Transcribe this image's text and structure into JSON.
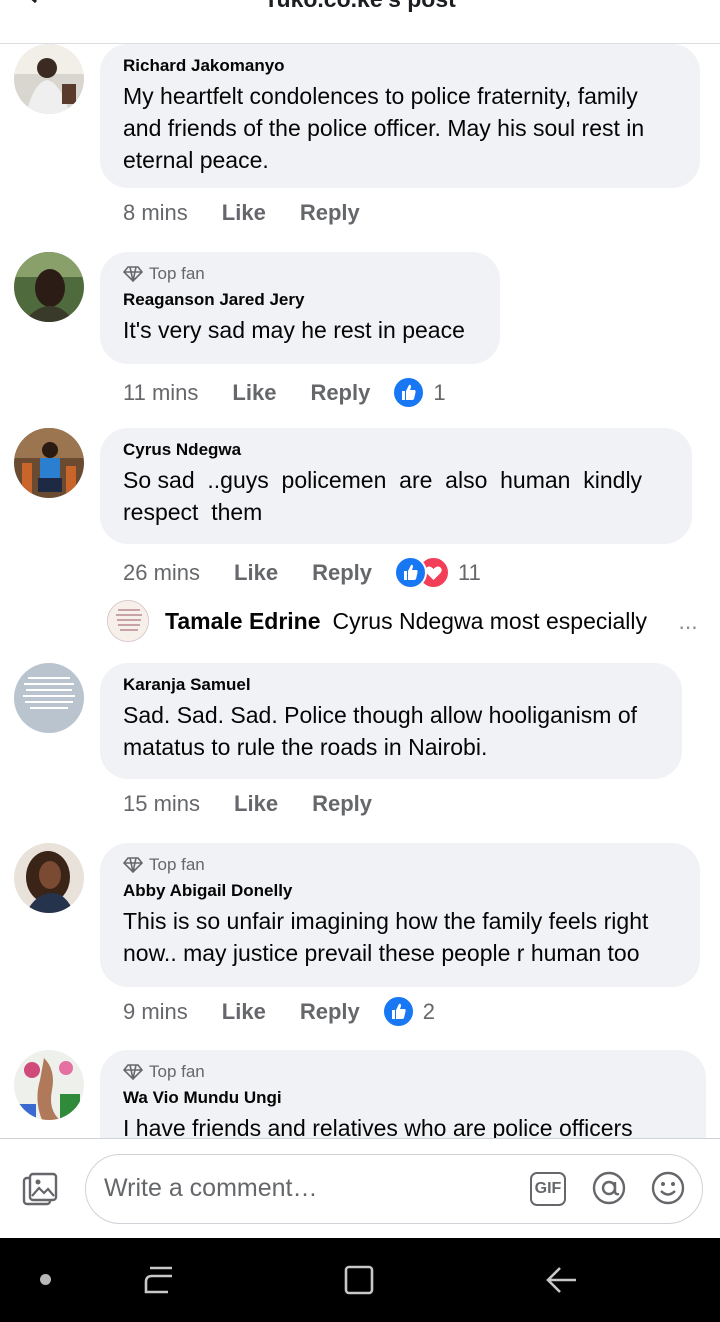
{
  "header": {
    "title": "Tuko.co.ke's post"
  },
  "comments": [
    {
      "author": "Richard Jakomanyo",
      "badge": "",
      "text": "My heartfelt condolences to police fraternity, family and friends of the police officer. May his soul rest in eternal peace.",
      "time": "8 mins",
      "like": "Like",
      "reply": "Reply",
      "reaction_count": ""
    },
    {
      "author": "Reaganson Jared Jery",
      "badge": "Top fan",
      "text": "It's very sad may he rest in peace",
      "time": "11 mins",
      "like": "Like",
      "reply": "Reply",
      "reaction_count": "1"
    },
    {
      "author": "Cyrus Ndegwa",
      "badge": "",
      "text": "So sad  ..guys  policemen  are  also  human  kindly respect  them",
      "time": "26 mins",
      "like": "Like",
      "reply": "Reply",
      "reaction_count": "11"
    },
    {
      "author": "Karanja Samuel",
      "badge": "",
      "text": "Sad. Sad. Sad. Police though allow hooliganism of matatus to rule the roads in Nairobi.",
      "time": "15 mins",
      "like": "Like",
      "reply": "Reply",
      "reaction_count": ""
    },
    {
      "author": "Abby Abigail Donelly",
      "badge": "Top fan",
      "text": "This is so unfair imagining how the family feels right now.. may justice prevail these people r human too",
      "time": "9 mins",
      "like": "Like",
      "reply": "Reply",
      "reaction_count": "2"
    },
    {
      "author": "Wa Vio Mundu Ungi",
      "badge": "Top fan",
      "text": "I have friends and relatives who are police officers",
      "time": "",
      "like": "",
      "reply": "",
      "reaction_count": ""
    }
  ],
  "reply_preview": {
    "author": "Tamale Edrine",
    "text": "Cyrus Ndegwa most especially",
    "more": "..."
  },
  "composer": {
    "placeholder": "Write a comment…",
    "gif_label": "GIF"
  },
  "icons": [
    "back-arrow-icon",
    "diamond-icon",
    "like-reaction-icon",
    "love-reaction-icon",
    "photo-icon",
    "gif-icon",
    "at-icon",
    "smile-icon",
    "recents-icon",
    "home-icon",
    "back-icon"
  ],
  "colors": {
    "bubble": "#f0f2f5",
    "secondary_text": "#65676b",
    "like_blue": "#1877f2",
    "love_red": "#f33e58",
    "nav_bar": "#000000"
  }
}
